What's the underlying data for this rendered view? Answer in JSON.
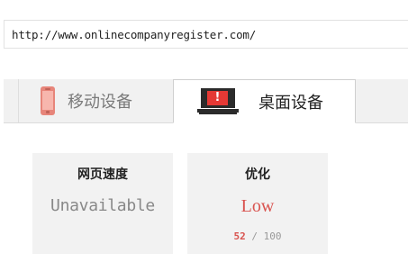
{
  "url_bar": {
    "url": "http://www.onlinecompanyregister.com/"
  },
  "tabs": [
    {
      "label": "移动设备",
      "icon": "mobile-phone-icon",
      "active": false
    },
    {
      "label": "桌面设备",
      "icon": "laptop-alert-icon",
      "active": true
    }
  ],
  "icons": {
    "laptop_alert_symbol": "!"
  },
  "cards": {
    "speed": {
      "title": "网页速度",
      "value": "Unavailable"
    },
    "optimization": {
      "title": "优化",
      "value": "Low",
      "score": "52",
      "separator": "/",
      "max": "100"
    }
  },
  "colors": {
    "accent_red": "#d9534f",
    "alert_red": "#e53935",
    "phone_red": "#e7857a",
    "card_bg": "#f2f2f2",
    "tab_strip_bg": "#f1f1f1"
  }
}
